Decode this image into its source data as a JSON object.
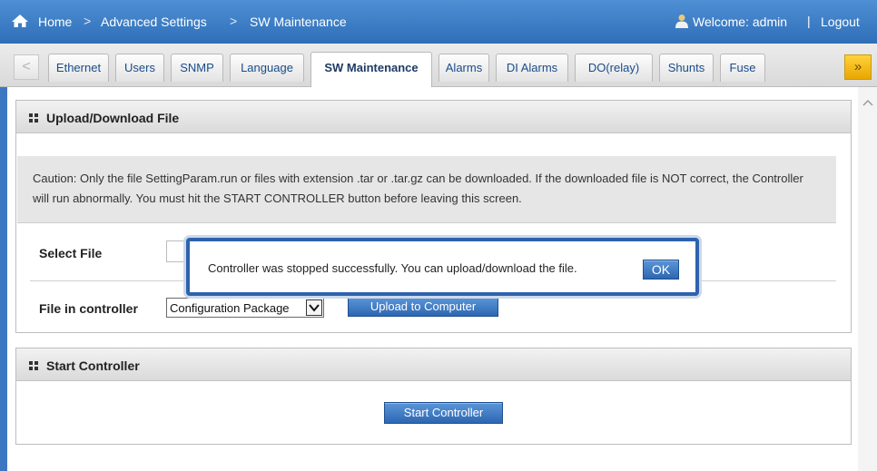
{
  "topbar": {
    "breadcrumbs": [
      "Home",
      "Advanced Settings",
      "SW Maintenance"
    ],
    "separator": ">",
    "welcome": "Welcome:  admin",
    "divider": "|",
    "logout": "Logout",
    "icons": {
      "home": "home-icon",
      "user": "user-icon"
    }
  },
  "tabs": {
    "prev": "<",
    "next": "»",
    "items": [
      {
        "label": "Ethernet"
      },
      {
        "label": "Users"
      },
      {
        "label": "SNMP"
      },
      {
        "label": "Language"
      },
      {
        "label": "SW Maintenance",
        "active": true
      },
      {
        "label": "Alarms"
      },
      {
        "label": "DI Alarms"
      },
      {
        "label": "DO(relay)"
      },
      {
        "label": "Shunts"
      },
      {
        "label": "Fuse"
      }
    ]
  },
  "upload_panel": {
    "title": "Upload/Download File",
    "caution": "Caution: Only the file SettingParam.run or files with extension .tar or .tar.gz can be downloaded. If the downloaded file is NOT correct, the Controller will run abnormally. You must hit the START CONTROLLER button before leaving this screen.",
    "select_file_label": "Select File",
    "file_in_controller_label": "File in controller",
    "file_select_value": "Configuration Package",
    "upload_button": "Upload to Computer"
  },
  "start_panel": {
    "title": "Start Controller",
    "start_button": "Start Controller"
  },
  "modal": {
    "message": "Controller was stopped successfully. You can upload/download the file.",
    "ok": "OK"
  },
  "colors": {
    "topbar": "#3a7cc6",
    "accent_blue": "#2d67b2",
    "tab_next": "#f2b400"
  }
}
